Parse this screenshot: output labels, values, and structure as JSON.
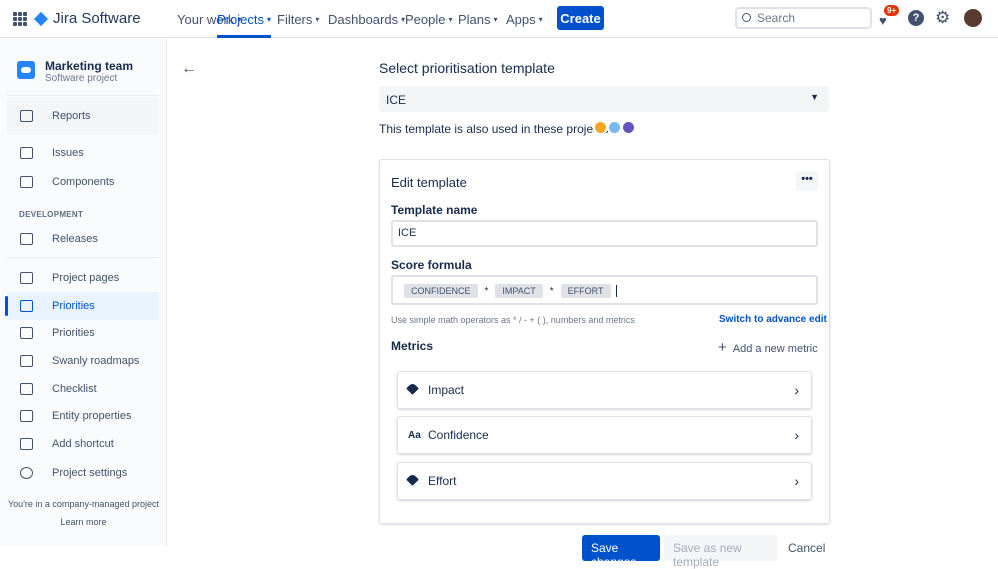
{
  "topnav": {
    "brand": "Jira Software",
    "items": [
      "Your work",
      "Projects",
      "Filters",
      "Dashboards",
      "People",
      "Plans",
      "Apps"
    ],
    "create": "Create",
    "search_placeholder": "Search",
    "notifications": "9+"
  },
  "sidebar": {
    "project_name": "Marketing team",
    "project_type": "Software project",
    "section": "DEVELOPMENT",
    "items": [
      "Reports",
      "Issues",
      "Components",
      "Releases",
      "Project pages",
      "Priorities",
      "Priorities",
      "Swanly roadmaps",
      "Checklist",
      "Entity properties",
      "Add shortcut",
      "Project settings"
    ],
    "footer": "You're in a company-managed project",
    "learn_more": "Learn more"
  },
  "main": {
    "title": "Select prioritisation template",
    "selected_template": "ICE",
    "used_in": "This template is also used in these projects:",
    "card": {
      "title": "Edit template",
      "more": "•••",
      "name_label": "Template name",
      "name_value": "ICE",
      "formula_label": "Score formula",
      "formula": [
        "CONFIDENCE",
        "*",
        "IMPACT",
        "*",
        "EFFORT"
      ],
      "hint": "Use simple math operators as * / - + ( ), numbers and metrics",
      "advanced": "Switch to advance edit",
      "metrics_label": "Metrics",
      "add_metric": "Add a new metric",
      "metrics": [
        {
          "name": "Impact",
          "icon": "tag-icon"
        },
        {
          "name": "Confidence",
          "icon": "Aa"
        },
        {
          "name": "Effort",
          "icon": "tag-icon"
        }
      ]
    },
    "save": "Save changes",
    "save_new": "Save as new template",
    "cancel": "Cancel"
  },
  "colors": {
    "primary": "#0052cc"
  }
}
